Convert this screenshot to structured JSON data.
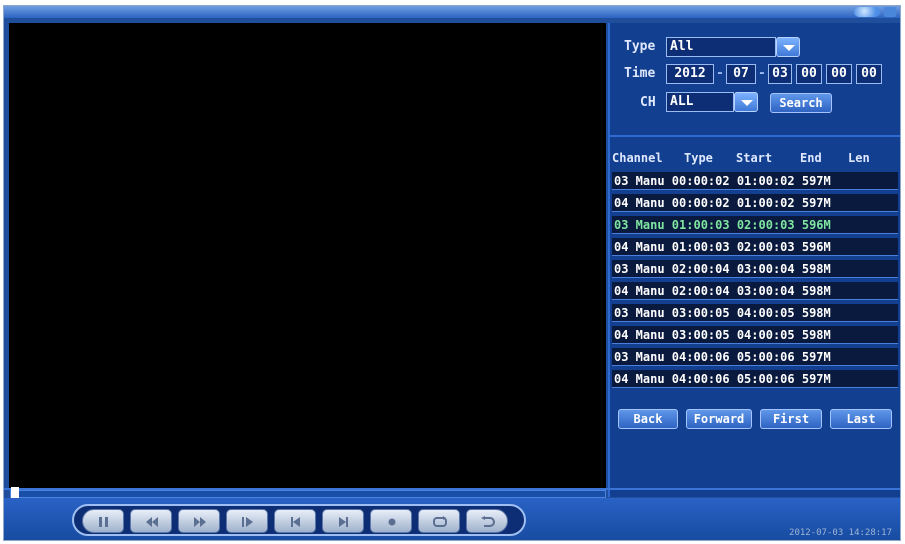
{
  "search": {
    "type_label": "Type",
    "type_value": "All",
    "time_label": "Time",
    "time": {
      "year": "2012",
      "sep1": "-",
      "month": "07",
      "sep2": "-",
      "day": "03",
      "hour": "00",
      "minute": "00",
      "second": "00"
    },
    "ch_label": "CH",
    "ch_value": "ALL",
    "search_label": "Search"
  },
  "list": {
    "headers": {
      "channel": "Channel",
      "type": "Type",
      "start": "Start",
      "end": "End",
      "len": "Len"
    },
    "rows": [
      "03 Manu 00:00:02 01:00:02 597M",
      "04 Manu 00:00:02 01:00:02 597M",
      "03 Manu 01:00:03 02:00:03 596M",
      "04 Manu 01:00:03 02:00:03 596M",
      "03 Manu 02:00:04 03:00:04 598M",
      "04 Manu 02:00:04 03:00:04 598M",
      "03 Manu 03:00:05 04:00:05 598M",
      "04 Manu 03:00:05 04:00:05 598M",
      "03 Manu 04:00:06 05:00:06 597M",
      "04 Manu 04:00:06 05:00:06 597M"
    ],
    "selected_index": 2
  },
  "nav": {
    "back": "Back",
    "forward": "Forward",
    "first": "First",
    "last": "Last"
  },
  "playback": {
    "progress": 0,
    "controls": [
      "pause-icon",
      "rewind-icon",
      "fast-forward-icon",
      "slow-play-icon",
      "previous-icon",
      "next-icon",
      "record-icon",
      "repeat-icon",
      "return-icon"
    ]
  },
  "status": {
    "timestamp": "2012-07-03 14:28:17"
  },
  "colors": {
    "selected_row_text": "#7fe6a0",
    "panel_bg": "#123f8f",
    "accent": "#2f6ad0"
  }
}
